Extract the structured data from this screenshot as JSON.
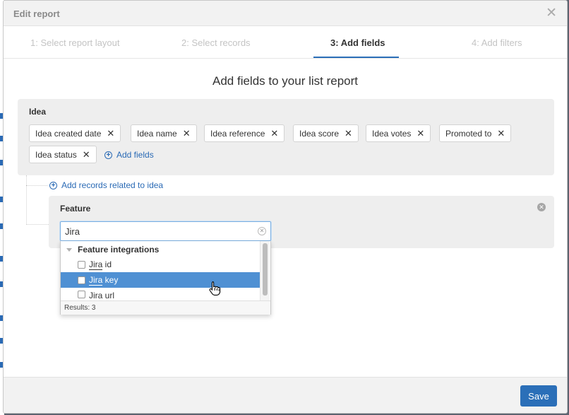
{
  "modal": {
    "title": "Edit report",
    "close_icon": "close-icon"
  },
  "tabs": [
    {
      "label": "1: Select report layout",
      "active": false
    },
    {
      "label": "2: Select records",
      "active": false
    },
    {
      "label": "3: Add fields",
      "active": true
    },
    {
      "label": "4: Add filters",
      "active": false
    }
  ],
  "heading": "Add fields to your list report",
  "idea": {
    "label": "Idea",
    "fields": [
      "Idea created date",
      "Idea name",
      "Idea reference",
      "Idea score",
      "Idea votes",
      "Promoted to",
      "Idea status"
    ],
    "add_fields_label": "Add fields"
  },
  "add_related_label": "Add records related to idea",
  "feature": {
    "label": "Feature",
    "search": {
      "value": "Jira",
      "placeholder": ""
    },
    "dropdown": {
      "group": "Feature integrations",
      "options": [
        {
          "match": "Jira",
          "rest": " id",
          "highlighted": false
        },
        {
          "match": "Jira",
          "rest": " key",
          "highlighted": true
        },
        {
          "match": "Jira",
          "rest": " url",
          "highlighted": false
        }
      ],
      "results": "Results: 3"
    }
  },
  "footer": {
    "save_label": "Save"
  },
  "colors": {
    "accent": "#2b6fb8",
    "highlight": "#4f90d3",
    "panel_bg": "#eeeeee"
  }
}
